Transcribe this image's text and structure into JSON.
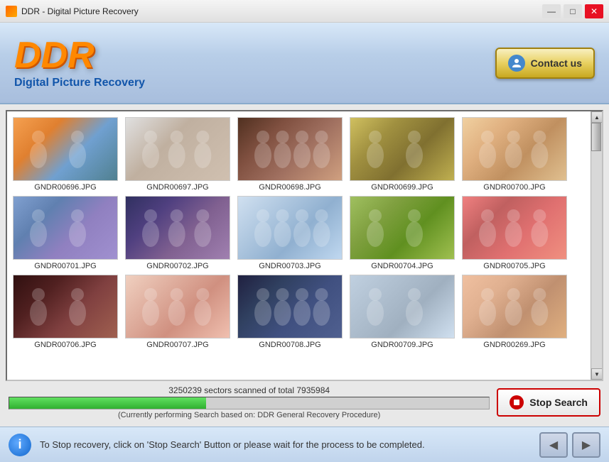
{
  "window": {
    "title": "DDR - Digital Picture Recovery",
    "controls": {
      "minimize": "—",
      "maximize": "□",
      "close": "✕"
    }
  },
  "header": {
    "logo": "DDR",
    "subtitle": "Digital Picture Recovery",
    "contact_btn": "Contact us"
  },
  "gallery": {
    "rows": [
      {
        "items": [
          {
            "name": "GNDR00696.JPG",
            "class": "img-people-1"
          },
          {
            "name": "GNDR00697.JPG",
            "class": "img-people-2"
          },
          {
            "name": "GNDR00698.JPG",
            "class": "img-people-3"
          },
          {
            "name": "GNDR00699.JPG",
            "class": "img-people-4"
          },
          {
            "name": "GNDR00700.JPG",
            "class": "img-people-5"
          }
        ]
      },
      {
        "items": [
          {
            "name": "GNDR00701.JPG",
            "class": "img-people-6"
          },
          {
            "name": "GNDR00702.JPG",
            "class": "img-people-7"
          },
          {
            "name": "GNDR00703.JPG",
            "class": "img-people-8"
          },
          {
            "name": "GNDR00704.JPG",
            "class": "img-people-9"
          },
          {
            "name": "GNDR00705.JPG",
            "class": "img-people-10"
          }
        ]
      },
      {
        "items": [
          {
            "name": "GNDR00706.JPG",
            "class": "img-people-11"
          },
          {
            "name": "GNDR00707.JPG",
            "class": "img-people-r1"
          },
          {
            "name": "GNDR00708.JPG",
            "class": "img-people-r2"
          },
          {
            "name": "GNDR00709.JPG",
            "class": "img-people-r3"
          },
          {
            "name": "GNDR00269.JPG",
            "class": "img-people-r4"
          }
        ]
      }
    ]
  },
  "progress": {
    "sectors_scanned": "3250239",
    "sectors_total": "7935984",
    "text": "3250239 sectors scanned of total 7935984",
    "status": "(Currently performing Search based on:  DDR General Recovery Procedure)",
    "fill_percent": 41,
    "stop_btn": "Stop Search"
  },
  "footer": {
    "info_char": "i",
    "message": "To Stop recovery, click on 'Stop Search' Button or please wait for the process to be completed.",
    "nav_back": "◀",
    "nav_forward": "▶"
  }
}
